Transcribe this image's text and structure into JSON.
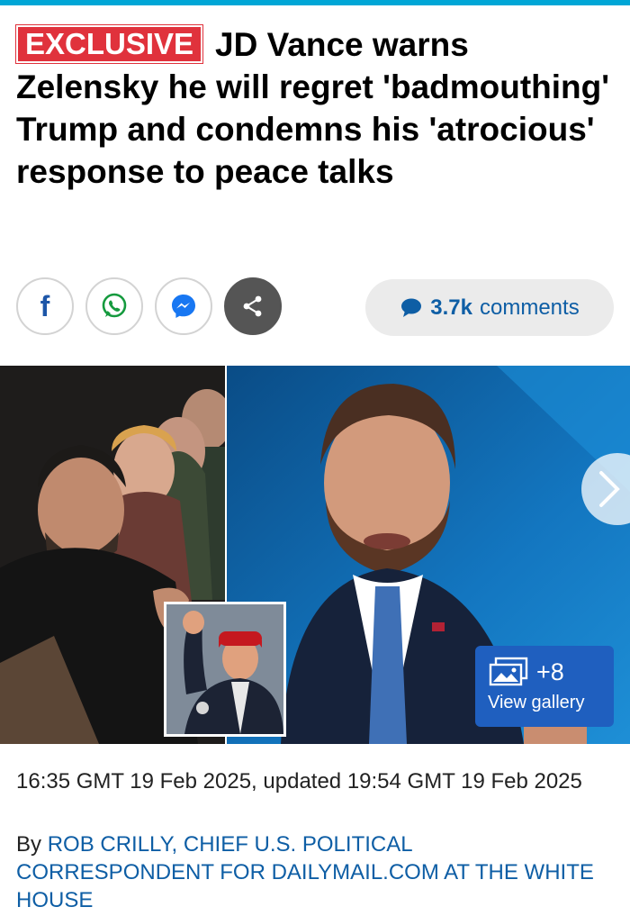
{
  "article": {
    "badge": "EXCLUSIVE",
    "headline": "JD Vance warns Zelensky he will regret 'badmouthing' Trump and condemns his 'atrocious' response to peace talks",
    "timestamp": "16:35 GMT 19 Feb 2025, updated 19:54 GMT 19 Feb 2025",
    "by_prefix": "By",
    "author": "ROB CRILLY, CHIEF U.S. POLITICAL CORRESPONDENT FOR DAILYMAIL.COM AT THE WHITE HOUSE"
  },
  "share": {
    "facebook_glyph": "f",
    "icons": [
      "facebook-icon",
      "whatsapp-icon",
      "messenger-icon",
      "share-icon"
    ]
  },
  "comments": {
    "count": "3.7k",
    "label": "comments"
  },
  "gallery": {
    "count": "+8",
    "label": "View gallery"
  },
  "colors": {
    "accent": "#00a6d6",
    "badge": "#e0323c",
    "link": "#0e5ea5",
    "gallery": "#1f5fbf"
  }
}
